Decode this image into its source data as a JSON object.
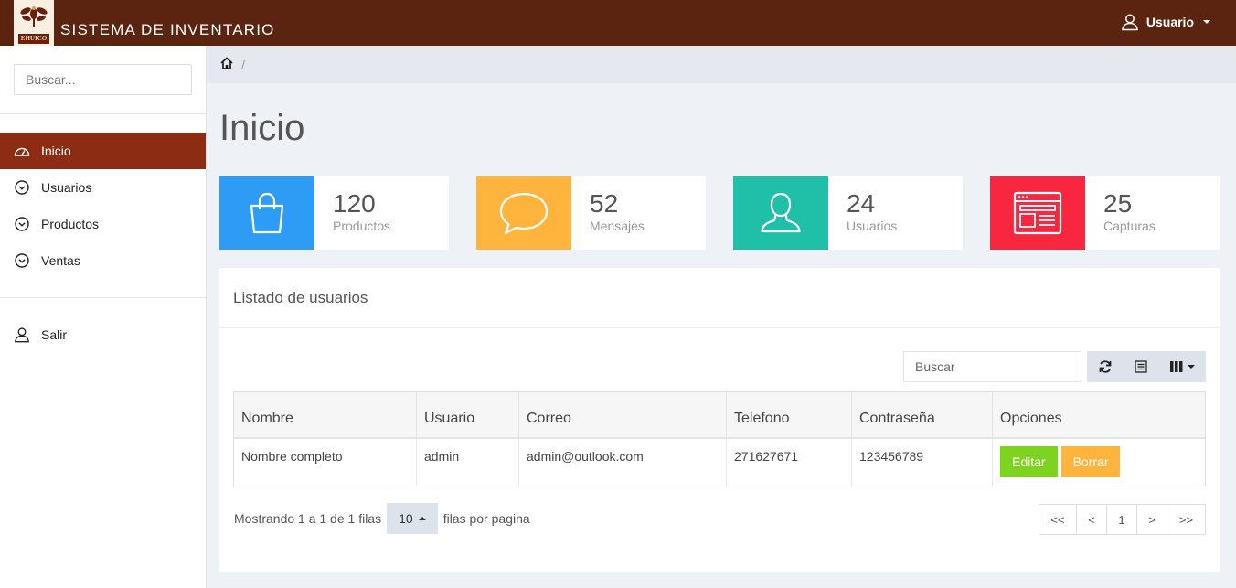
{
  "header": {
    "logo_text": "EHUICO",
    "app_title": "SISTEMA DE INVENTARIO",
    "user_label": "Usuario"
  },
  "sidebar": {
    "search_placeholder": "Buscar...",
    "items": [
      {
        "label": "Inicio",
        "icon": "dashboard-icon",
        "active": true
      },
      {
        "label": "Usuarios",
        "icon": "chevron-circle-icon",
        "active": false
      },
      {
        "label": "Productos",
        "icon": "chevron-circle-icon",
        "active": false
      },
      {
        "label": "Ventas",
        "icon": "chevron-circle-icon",
        "active": false
      }
    ],
    "logout_label": "Salir"
  },
  "breadcrumb": {
    "separator": "/"
  },
  "main": {
    "title": "Inicio",
    "stats": [
      {
        "value": "120",
        "label": "Productos",
        "color": "#2e9cf5",
        "icon": "shopping-bag-icon"
      },
      {
        "value": "52",
        "label": "Mensajes",
        "color": "#ffb43d",
        "icon": "chat-bubble-icon"
      },
      {
        "value": "24",
        "label": "Usuarios",
        "color": "#20bfa8",
        "icon": "user-icon"
      },
      {
        "value": "25",
        "label": "Capturas",
        "color": "#f8263f",
        "icon": "browser-window-icon"
      }
    ]
  },
  "users_panel": {
    "title": "Listado de usuarios",
    "search_placeholder": "Buscar",
    "columns": [
      "Nombre",
      "Usuario",
      "Correo",
      "Telefono",
      "Contraseña",
      "Opciones"
    ],
    "rows": [
      {
        "nombre": "Nombre completo",
        "usuario": "admin",
        "correo": "admin@outlook.com",
        "telefono": "271627671",
        "contrasena": "123456789"
      }
    ],
    "edit_label": "Editar",
    "delete_label": "Borrar",
    "showing_text": "Mostrando 1 a 1 de 1 filas",
    "page_size": "10",
    "per_page_text": "filas por pagina",
    "pager": [
      "<<",
      "<",
      "1",
      ">",
      ">>"
    ]
  }
}
